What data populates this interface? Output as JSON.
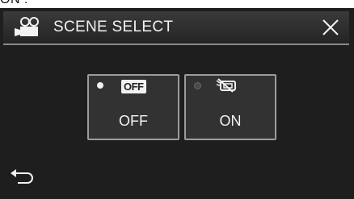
{
  "caption": "ON :",
  "header": {
    "title": "SCENE SELECT"
  },
  "icons": {
    "mode": "video-camera-icon",
    "close": "close-icon",
    "back": "back-arrow-icon",
    "stabilizer_off": "stabilizer-off-icon"
  },
  "options": [
    {
      "badge": "OFF",
      "label": "OFF",
      "selected": true
    },
    {
      "label": "ON",
      "selected": false
    }
  ]
}
